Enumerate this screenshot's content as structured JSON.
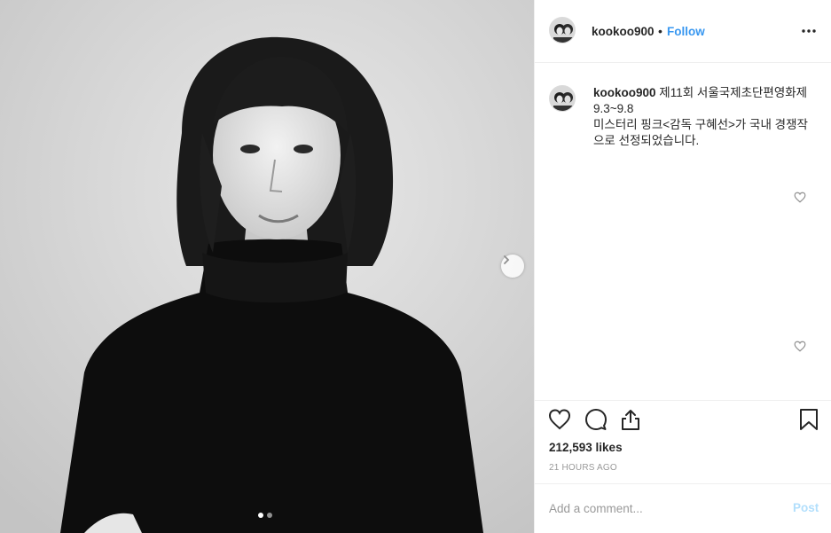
{
  "post": {
    "username": "kookoo900",
    "follow_label": "Follow",
    "separator": "•",
    "caption_line1": "제11회 서울국제초단편영화제 9.3~9.8",
    "caption_line2": "미스터리 핑크<감독 구혜선>가 국내 경쟁작으로 선정되었습니다.",
    "likes": "212,593 likes",
    "time": "21 HOURS AGO",
    "comment_placeholder": "Add a comment...",
    "post_label": "Post",
    "carousel": {
      "count": 2,
      "active": 1
    }
  },
  "icons": {
    "more": "more-options-icon",
    "next": "chevron-right-icon",
    "like": "heart-icon",
    "comment": "comment-icon",
    "share": "share-icon",
    "save": "bookmark-icon"
  },
  "colors": {
    "link": "#3897f0",
    "post_disabled": "#b2dffc",
    "muted": "#999999",
    "text": "#262626"
  }
}
